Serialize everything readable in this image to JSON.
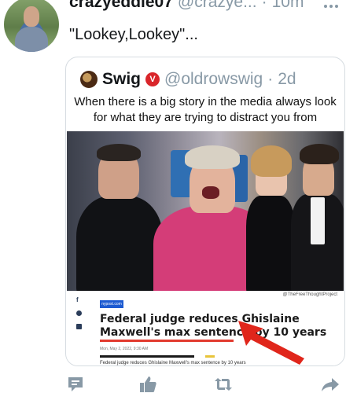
{
  "tweet": {
    "display_name": "crazyeddie07",
    "handle": "@crazye...",
    "separator": "·",
    "time": "10m",
    "text": "\"Lookey,Lookey\"..."
  },
  "quoted": {
    "display_name": "Swig",
    "badge_glyph": "V",
    "handle": "@oldrowswig",
    "separator": "·",
    "time": "2d",
    "image": {
      "caption": "When there is a big story in the media always look for what they are trying to distract you from",
      "watermark": "@TheFreeThoughtProject",
      "publisher_logo": "nypost.com",
      "headline": "Federal judge reduces Ghislaine Maxwell's max sentence by 10 years",
      "dateline": "Mon, May 2, 2022, 9:30 AM",
      "snippet": "Federal judge reduces Ghislaine Maxwell's max sentence by 10 years",
      "share_icons": [
        "facebook-icon",
        "twitter-icon",
        "email-icon"
      ]
    }
  },
  "colors": {
    "muted": "#8899a6",
    "text": "#14171a",
    "accent": "#d9252a",
    "underline": "#e23a2e",
    "action_icons": "#8899a6"
  },
  "actions": [
    "reply-icon",
    "like-icon",
    "retweet-icon",
    "share-icon"
  ]
}
